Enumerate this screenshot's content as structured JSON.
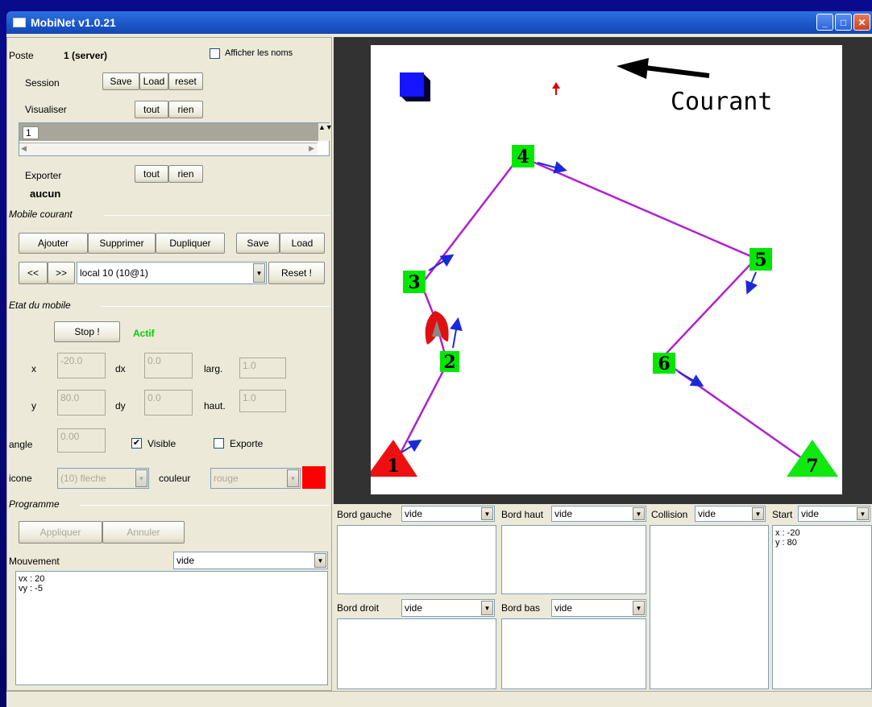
{
  "window": {
    "title": "MobiNet v1.0.21"
  },
  "left": {
    "poste_label": "Poste",
    "poste_value": "1 (server)",
    "afficher_noms": "Afficher les noms",
    "session_label": "Session",
    "session_save": "Save",
    "session_load": "Load",
    "session_reset": "reset",
    "visualiser_label": "Visualiser",
    "tout": "tout",
    "rien": "rien",
    "list_item": "1",
    "exporter_label": "Exporter",
    "exporter_value": "aucun",
    "mobile_courant": "Mobile courant",
    "ajouter": "Ajouter",
    "supprimer": "Supprimer",
    "dupliquer": "Dupliquer",
    "save": "Save",
    "load": "Load",
    "prev": "<<",
    "next": ">>",
    "mobile_select": "local 10 (10@1)",
    "reset_btn": "Reset !",
    "etat_mobile": "Etat du mobile",
    "stop": "Stop !",
    "actif": "Actif",
    "x_label": "x",
    "x_value": "-20.0",
    "dx_label": "dx",
    "dx_value": "0.0",
    "larg_label": "larg.",
    "larg_value": "1.0",
    "y_label": "y",
    "y_value": "80.0",
    "dy_label": "dy",
    "dy_value": "0.0",
    "haut_label": "haut.",
    "haut_value": "1.0",
    "angle_label": "angle",
    "angle_value": "0.00",
    "visible": "Visible",
    "exporte": "Exporte",
    "icone_label": "icone",
    "icone_value": "(10) fleche",
    "couleur_label": "couleur",
    "couleur_value": "rouge",
    "couleur_swatch": "#ff0000",
    "programme": "Programme",
    "appliquer": "Appliquer",
    "annuler": "Annuler",
    "mouvement_label": "Mouvement",
    "mouvement_value": "vide",
    "mouvement_text": "vx : 20\nvy : -5"
  },
  "canvas": {
    "annotation": "Courant",
    "nodes": [
      "1",
      "2",
      "3",
      "4",
      "5",
      "6",
      "7"
    ]
  },
  "events": {
    "bord_gauche": "Bord gauche",
    "bord_gauche_value": "vide",
    "bord_haut": "Bord haut",
    "bord_haut_value": "vide",
    "collision": "Collision",
    "collision_value": "vide",
    "start": "Start",
    "start_value": "vide",
    "start_text": "x : -20\ny : 80",
    "bord_droit": "Bord droit",
    "bord_droit_value": "vide",
    "bord_bas": "Bord bas",
    "bord_bas_value": "vide"
  }
}
